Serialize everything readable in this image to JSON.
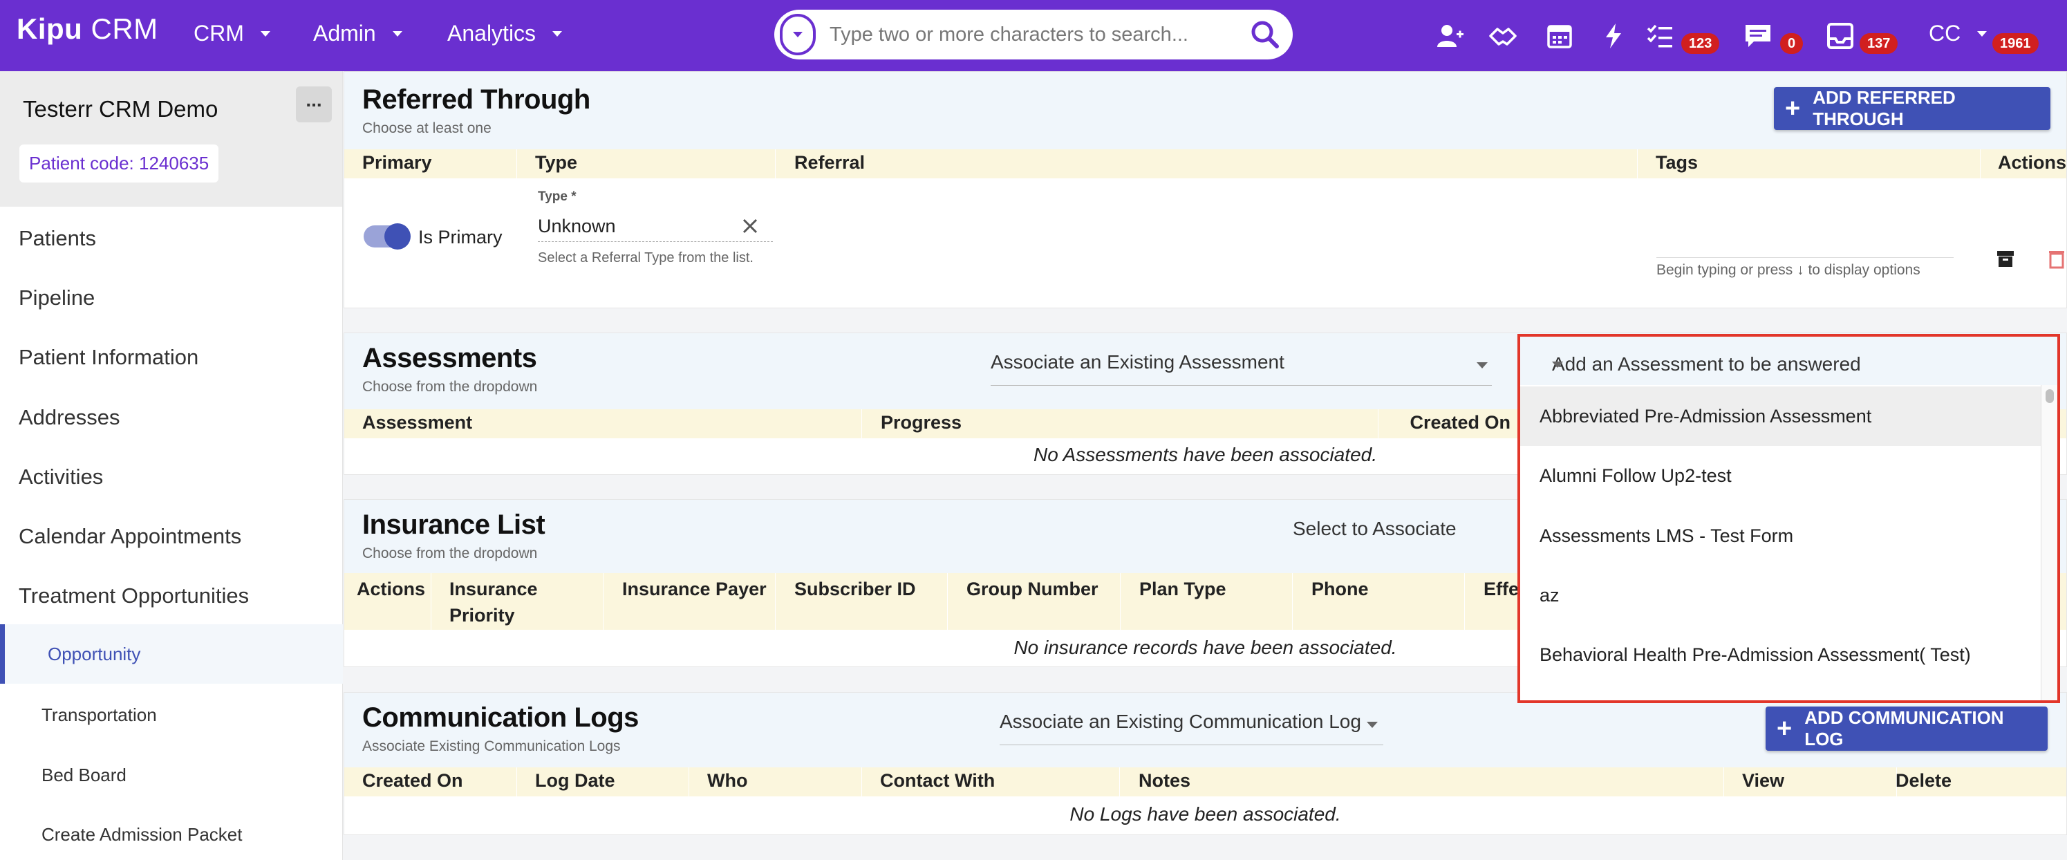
{
  "header": {
    "logo_a": "Kipu",
    "logo_b": " CRM",
    "nav": [
      "CRM",
      "Admin",
      "Analytics"
    ],
    "search_placeholder": "Type two or more characters to search...",
    "badges": {
      "tasks": "123",
      "messages": "0",
      "inbox": "137",
      "user": "1961"
    },
    "user_initials": "CC",
    "colors": {
      "brand": "#6a2fd0",
      "badge": "#d11f1f"
    }
  },
  "sidebar": {
    "title": "Testerr CRM Demo",
    "more": "...",
    "patient_code": "Patient code: 1240635",
    "items": [
      "Patients",
      "Pipeline",
      "Patient Information",
      "Addresses",
      "Activities",
      "Calendar Appointments",
      "Treatment Opportunities"
    ],
    "subitems": [
      "Opportunity",
      "Transportation",
      "Bed Board",
      "Create Admission Packet"
    ],
    "active": "Opportunity"
  },
  "referred": {
    "title": "Referred Through",
    "subtitle": "Choose at least one",
    "add_button": "ADD REFERRED THROUGH",
    "columns": [
      "Primary",
      "Type",
      "Referral",
      "Tags",
      "Actions"
    ],
    "is_primary_label": "Is Primary",
    "type_label": "Type *",
    "type_value": "Unknown",
    "type_helper": "Select a Referral Type from the list.",
    "tags_placeholder": "Begin typing or press ↓ to display options"
  },
  "assessments": {
    "title": "Assessments",
    "subtitle": "Choose from the dropdown",
    "associate_select": "Associate an Existing Assessment",
    "columns": [
      "Assessment",
      "Progress",
      "Created On"
    ],
    "empty": "No Assessments have been associated."
  },
  "assessment_dropdown": {
    "label": "Add an Assessment to be answered",
    "options": [
      "Abbreviated Pre-Admission Assessment",
      "Alumni Follow Up2-test",
      "Assessments LMS - Test Form",
      "az",
      "Behavioral Health Pre-Admission Assessment( Test)"
    ],
    "highlighted": "Abbreviated Pre-Admission Assessment"
  },
  "insurance": {
    "title": "Insurance List",
    "subtitle": "Choose from the dropdown",
    "associate_select": "Select to Associate",
    "columns": [
      "Actions",
      "Insurance Priority",
      "Insurance Payer",
      "Subscriber ID",
      "Group Number",
      "Plan Type",
      "Phone",
      "Effe"
    ],
    "empty": "No insurance records have been associated."
  },
  "communication": {
    "title": "Communication Logs",
    "subtitle": "Associate Existing Communication Logs",
    "associate_select": "Associate an Existing Communication Log",
    "add_button": "ADD COMMUNICATION LOG",
    "columns": [
      "Created On",
      "Log Date",
      "Who",
      "Contact With",
      "Notes",
      "View",
      "Delete"
    ],
    "empty": "No Logs have been associated."
  }
}
